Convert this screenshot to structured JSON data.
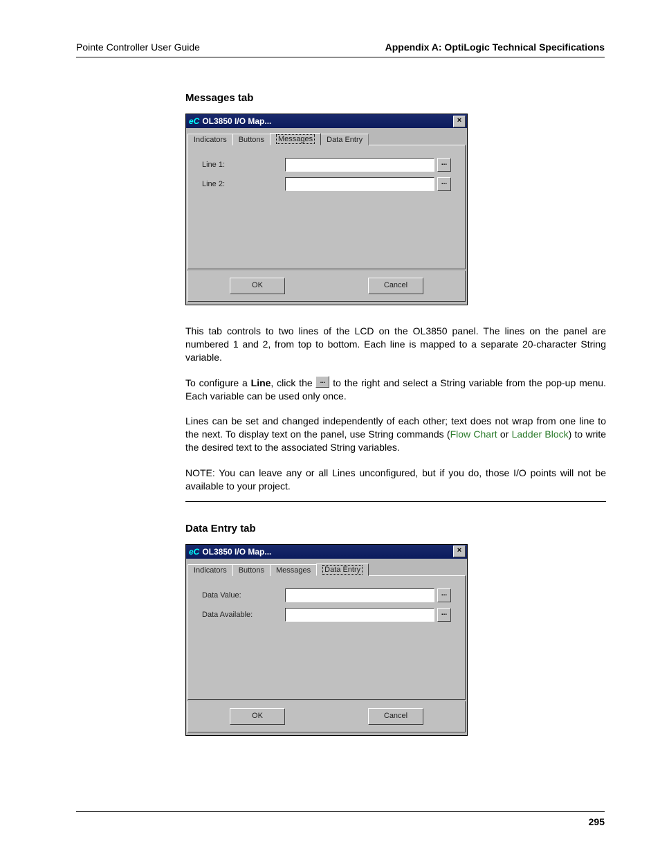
{
  "header": {
    "left": "Pointe Controller User Guide",
    "right": "Appendix A: OptiLogic Technical Specifications"
  },
  "page_number": "295",
  "sections": {
    "messages": {
      "title": "Messages tab",
      "dialog": {
        "title": "OL3850 I/O Map...",
        "logo_text": "eC",
        "tabs": [
          "Indicators",
          "Buttons",
          "Messages",
          "Data Entry"
        ],
        "active_tab": 2,
        "rows": [
          {
            "label": "Line 1:"
          },
          {
            "label": "Line 2:"
          }
        ],
        "ok": "OK",
        "cancel": "Cancel",
        "ellipsis": "..."
      },
      "para1": "This tab controls to two lines of the LCD on the OL3850 panel. The lines on the panel are numbered 1 and 2, from top to bottom. Each line is mapped to a separate 20-character String variable.",
      "para2_a": "To configure a ",
      "para2_bold": "Line",
      "para2_b": ", click the ",
      "para2_c": " to the right and select a String variable from the pop-up menu. Each variable can be used only once.",
      "inline_btn_label": "...",
      "para3_a": "Lines can be set and changed independently of each other; text does not wrap from one line to the next. To display text on the panel, use String commands (",
      "link1": "Flow Chart",
      "para3_b": " or ",
      "link2": "Ladder Block",
      "para3_c": ") to write the desired text to the associated String variables.",
      "note": "NOTE: You can leave any or all Lines unconfigured, but if you do, those I/O points will not be available to your project."
    },
    "dataentry": {
      "title": "Data Entry tab",
      "dialog": {
        "title": "OL3850 I/O Map...",
        "logo_text": "eC",
        "tabs": [
          "Indicators",
          "Buttons",
          "Messages",
          "Data Entry"
        ],
        "active_tab": 3,
        "rows": [
          {
            "label": "Data Value:"
          },
          {
            "label": "Data Available:"
          }
        ],
        "ok": "OK",
        "cancel": "Cancel",
        "ellipsis": "..."
      }
    }
  }
}
